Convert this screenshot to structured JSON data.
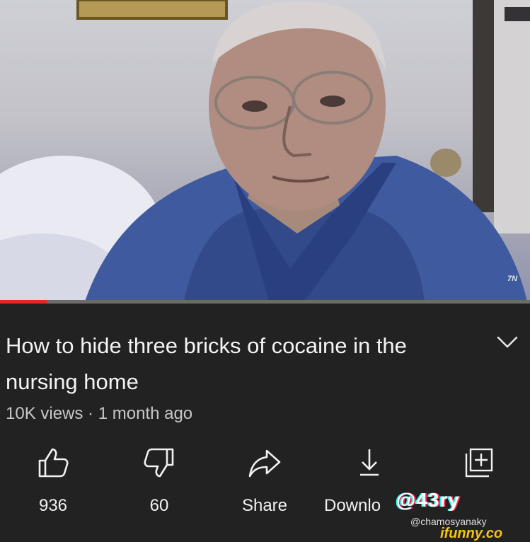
{
  "video": {
    "progress_fraction": 0.088,
    "corner_label": "7N"
  },
  "info": {
    "title": "How to hide three bricks of cocaine in the nursing home",
    "stats": "10K views · 1 month ago"
  },
  "actions": [
    {
      "label": "936",
      "icon": "thumbs-up-icon"
    },
    {
      "label": "60",
      "icon": "thumbs-down-icon"
    },
    {
      "label": "Share",
      "icon": "share-icon"
    },
    {
      "label": "Downlo",
      "icon": "download-icon"
    },
    {
      "label": "",
      "icon": "add-to-playlist-icon"
    }
  ],
  "watermarks": {
    "tiktok": "@43ry",
    "handle": "@chamosyanaky",
    "ifunny": "ifunny.co"
  },
  "colors": {
    "background": "#222222",
    "progress": "#e3262b",
    "text": "#f4f4f4",
    "secondary_text": "#c7c7c7"
  }
}
